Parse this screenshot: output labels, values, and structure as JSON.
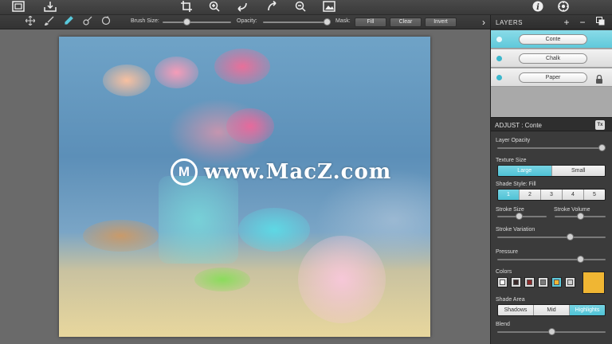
{
  "colors": {
    "accent": "#5fc9da",
    "panel_bg": "#3b3b3b",
    "selected_color": "#f0b633"
  },
  "top_toolbar": {
    "icons": [
      "frame-icon",
      "save-tray-icon",
      "crop-icon",
      "zoom-in-icon",
      "undo-icon",
      "redo-icon",
      "zoom-out-icon",
      "image-icon",
      "info-icon",
      "settings-icon"
    ]
  },
  "options": {
    "brush_size_label": "Brush Size:",
    "opacity_label": "Opacity:",
    "mask_label": "Mask:",
    "fill": "Fill",
    "clear": "Clear",
    "invert": "Invert",
    "brush_size_value": 0.35,
    "opacity_value": 0.98
  },
  "canvas": {
    "watermark_text": "www.MacZ.com"
  },
  "layers": {
    "title": "LAYERS",
    "add": "+",
    "remove": "−",
    "items": [
      {
        "label": "Conte",
        "selected": true,
        "locked": false
      },
      {
        "label": "Chalk",
        "selected": false,
        "locked": false
      },
      {
        "label": "Paper",
        "selected": false,
        "locked": true
      }
    ]
  },
  "adjust": {
    "title": "ADJUST : Conte",
    "layer_opacity": {
      "label": "Layer Opacity",
      "value": 0.97
    },
    "texture_size": {
      "label": "Texture Size",
      "options": [
        "Large",
        "Small"
      ],
      "selected": "Large"
    },
    "shade_style": {
      "label": "Shade Style: Fill",
      "options": [
        "1",
        "2",
        "3",
        "4",
        "5"
      ],
      "selected": "1"
    },
    "stroke_size": {
      "label": "Stroke Size",
      "value": 0.45
    },
    "stroke_volume": {
      "label": "Stroke Volume",
      "value": 0.5
    },
    "stroke_variation": {
      "label": "Stroke Variation",
      "value": 0.67
    },
    "pressure": {
      "label": "Pressure",
      "value": 0.77
    },
    "colors": {
      "label": "Colors",
      "swatches": [
        "#ffffff",
        "#3a2a2a",
        "#8b2a2a",
        "#7a7a7a",
        "#f0b633",
        "#cccccc"
      ],
      "selected_index": 4
    },
    "shade_area": {
      "label": "Shade Area",
      "options": [
        "Shadows",
        "Mid",
        "Highlights"
      ],
      "selected": "Highlights"
    },
    "blend": {
      "label": "Blend",
      "value": 0.5
    }
  }
}
